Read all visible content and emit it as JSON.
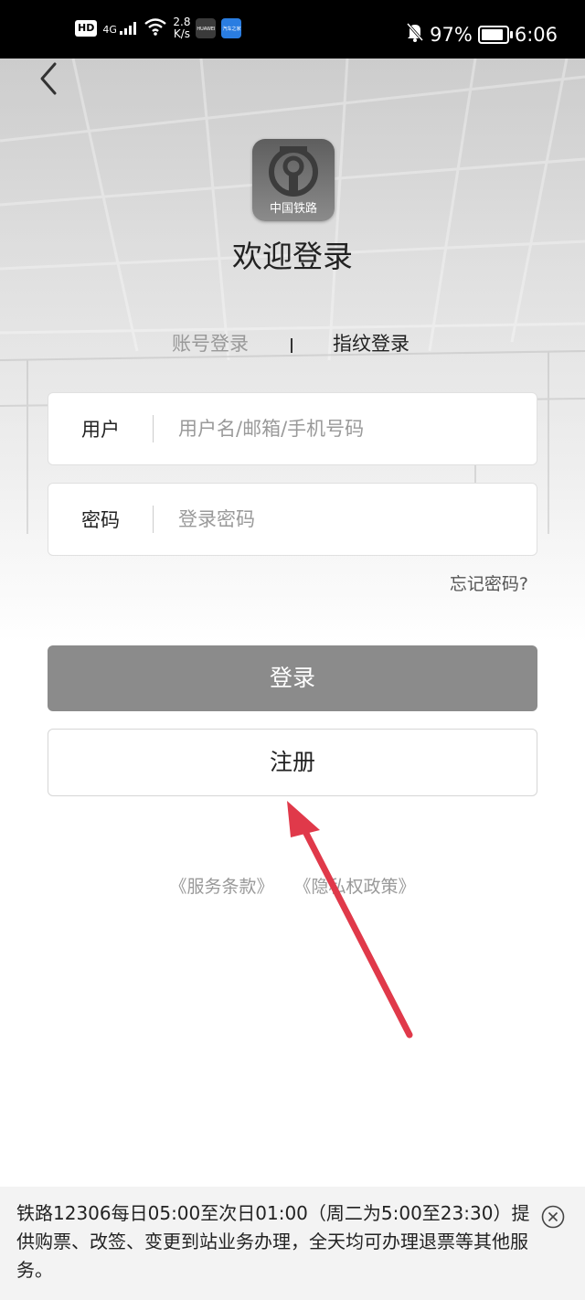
{
  "status_bar": {
    "hd": "HD",
    "signal": "4G",
    "speed_value": "2.8",
    "speed_unit": "K/s",
    "app1": "HUAWEI",
    "app2": "汽车之家",
    "battery": "97%",
    "battery_level": 0.97,
    "time": "6:06"
  },
  "header": {
    "logo_text": "中国铁路",
    "welcome": "欢迎登录"
  },
  "tabs": {
    "account": "账号登录",
    "fingerprint": "指纹登录"
  },
  "form": {
    "user_label": "用户",
    "user_placeholder": "用户名/邮箱/手机号码",
    "password_label": "密码",
    "password_placeholder": "登录密码",
    "forgot": "忘记密码?"
  },
  "buttons": {
    "login": "登录",
    "register": "注册"
  },
  "policies": {
    "terms": "《服务条款》",
    "privacy": "《隐私权政策》"
  },
  "notice": {
    "text": "铁路12306每日05:00至次日01:00（周二为5:00至23:30）提供购票、改签、变更到站业务办理，全天均可办理退票等其他服务。"
  },
  "colors": {
    "login_button": "#8b8b8b",
    "arrow": "#e0394a"
  }
}
